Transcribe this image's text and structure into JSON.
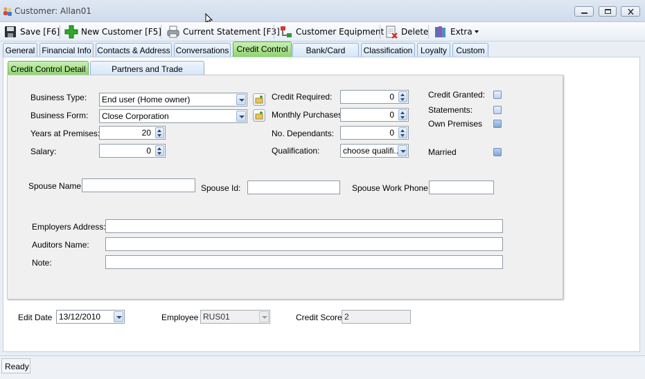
{
  "window": {
    "title": "Customer: Allan01",
    "icons": [
      "people-icon",
      "minimize-icon",
      "maximize-icon",
      "close-icon"
    ]
  },
  "toolbar": {
    "save_label": "Save [F6]",
    "new_customer_label": "New Customer [F5]",
    "current_statement_label": "Current Statement [F3]",
    "customer_equipment_label": "Customer Equipment",
    "delete_label": "Delete",
    "extra_label": "Extra"
  },
  "tabs": [
    "General",
    "Financial Info",
    "Contacts & Address",
    "Conversations",
    "Credit Control",
    "Bank/Card Details",
    "Classification",
    "Loyalty",
    "Custom"
  ],
  "active_tab": "Credit Control",
  "subtabs": [
    "Credit Control Detail",
    "Partners and Trade References"
  ],
  "active_subtab": "Credit Control Detail",
  "form": {
    "business_type_label": "Business Type:",
    "business_type_value": "End user (Home owner)",
    "business_form_label": "Business Form:",
    "business_form_value": "Close Corporation",
    "years_label": "Years at Premises:",
    "years_value": "20",
    "salary_label": "Salary:",
    "salary_value": "0",
    "credit_required_label": "Credit Required:",
    "credit_required_value": "0",
    "monthly_purchases_label": "Monthly Purchases:",
    "monthly_purchases_value": "0",
    "dependants_label": "No. Dependants:",
    "dependants_value": "0",
    "qualification_label": "Qualification:",
    "qualification_value": "choose qualifi...",
    "credit_granted_label": "Credit Granted:",
    "statements_label": "Statements:",
    "own_premises_label": "Own Premises",
    "married_label": "Married",
    "spouse_name_label": "Spouse Name:",
    "spouse_name_value": "",
    "spouse_id_label": "Spouse Id:",
    "spouse_id_value": "",
    "spouse_phone_label": "Spouse Work Phone:",
    "spouse_phone_value": "",
    "employers_address_label": "Employers Address:",
    "employers_address_value": "",
    "auditors_name_label": "Auditors Name:",
    "auditors_name_value": "",
    "note_label": "Note:",
    "note_value": ""
  },
  "footer": {
    "edit_date_label": "Edit Date",
    "edit_date_value": "13/12/2010",
    "employee_label": "Employee",
    "employee_value": "RUS01",
    "credit_score_label": "Credit Score",
    "credit_score_value": "2"
  },
  "status": {
    "text": "Ready"
  }
}
